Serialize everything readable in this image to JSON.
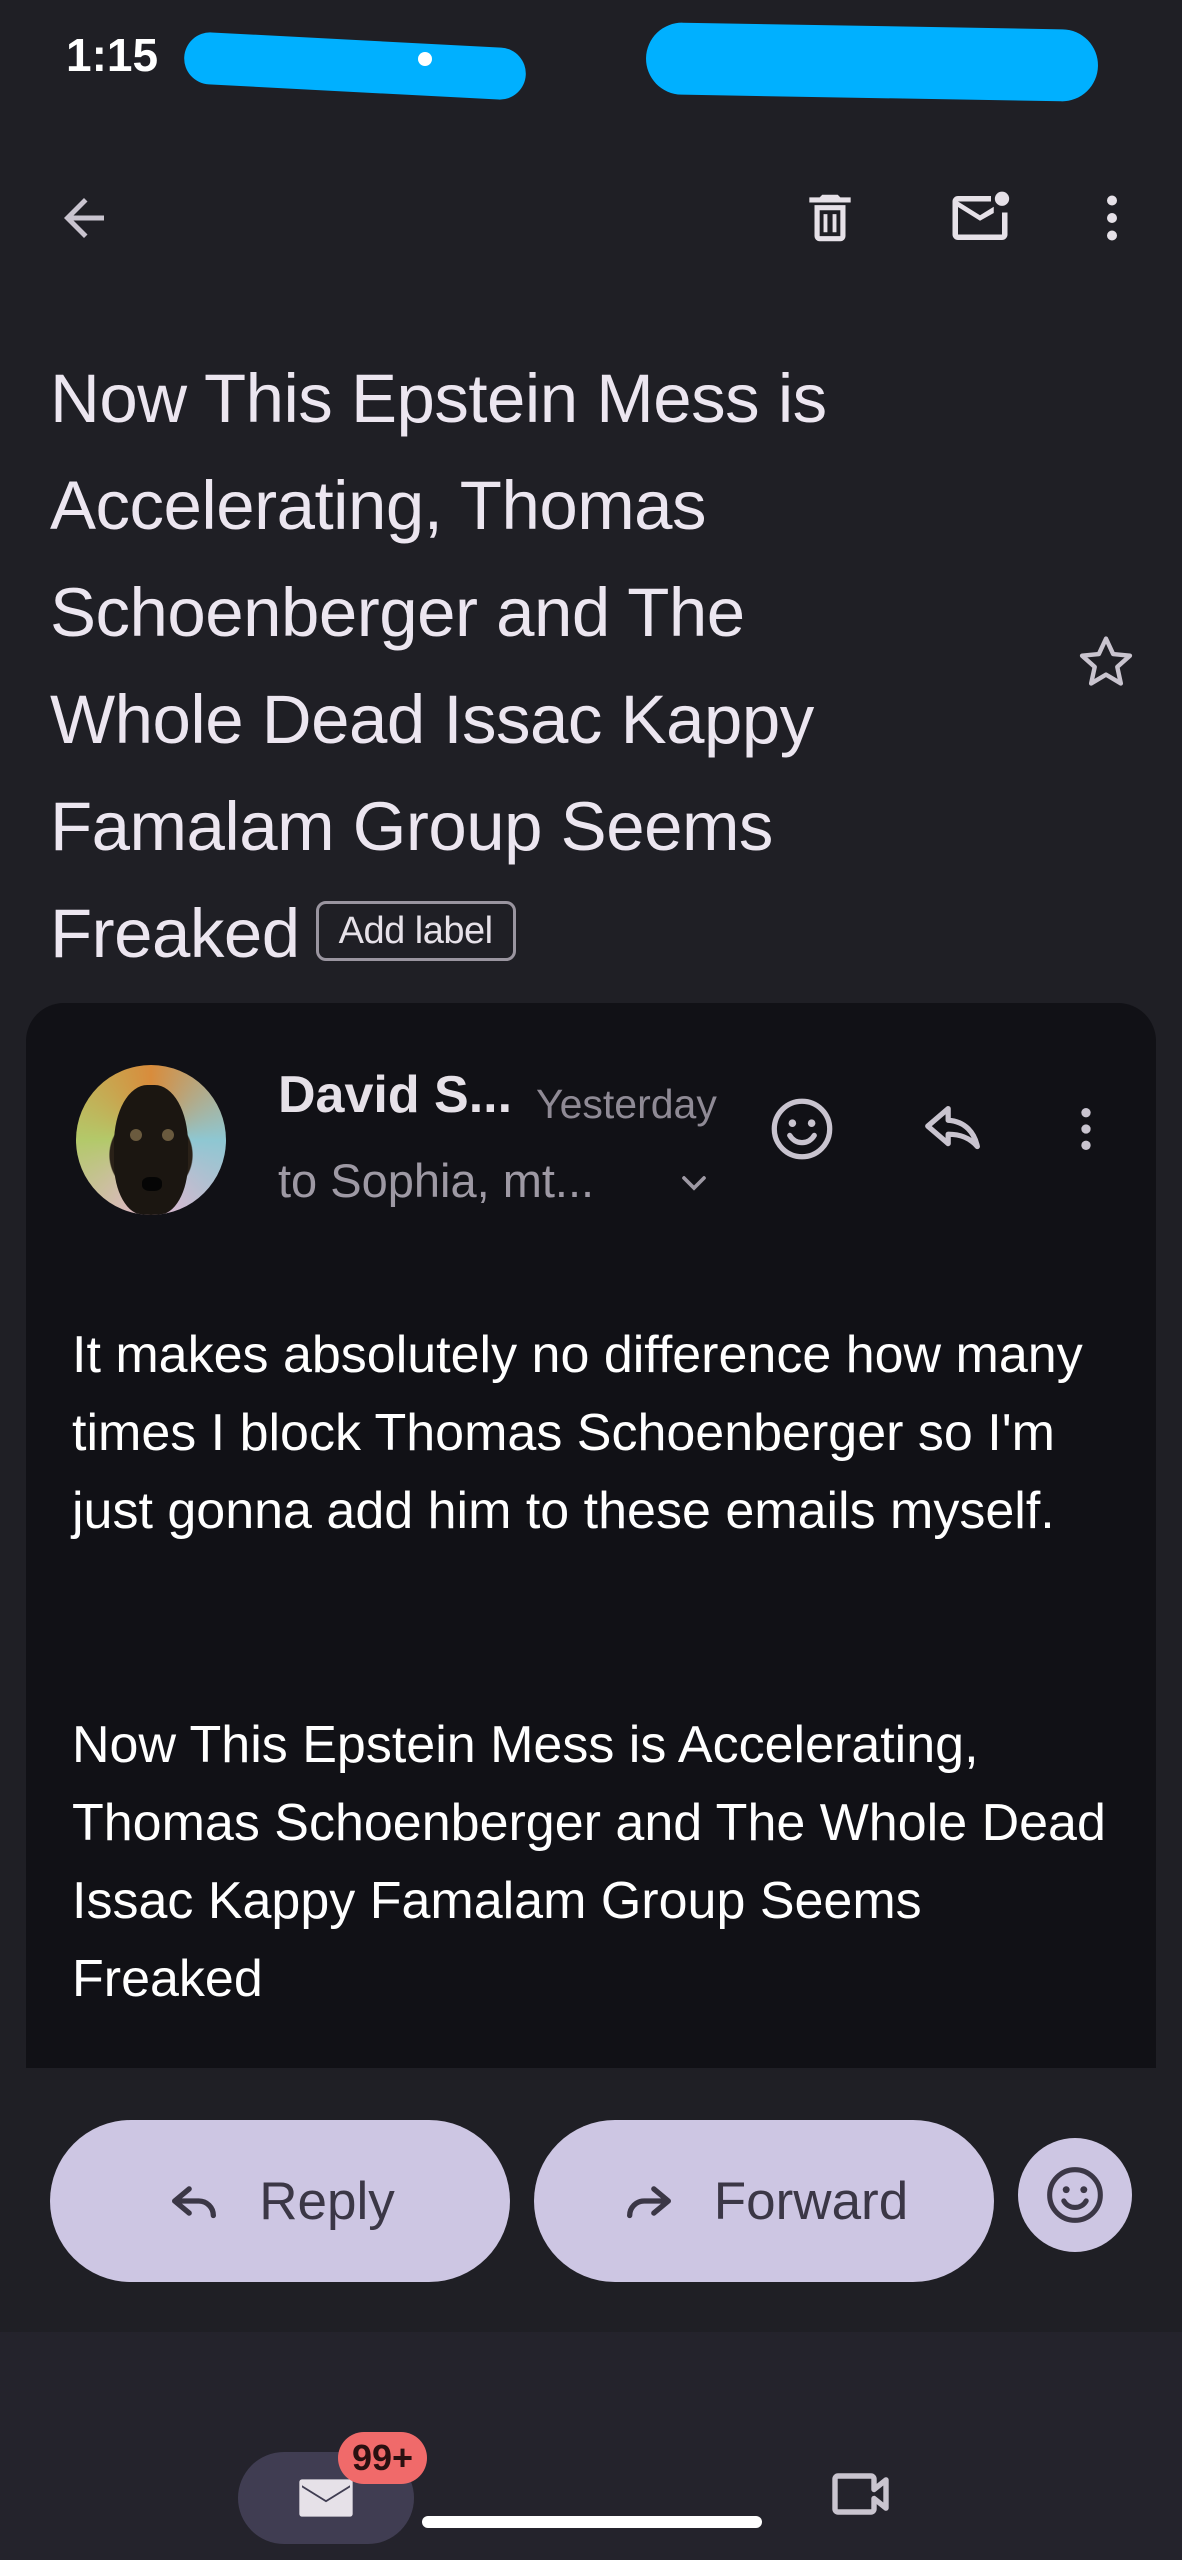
{
  "status_bar": {
    "time": "1:15"
  },
  "email": {
    "subject": "Now This Epstein Mess is Accelerating, Thomas Schoenberger and The Whole Dead Issac Kappy Famalam Group Seems Freaked",
    "add_label": "Add label",
    "sender": "David S...",
    "date": "Yesterday",
    "recipients": "to Sophia, mt...",
    "body_paragraphs": [
      "It makes absolutely no difference how many times I block Thomas Schoenberger so I'm just gonna add him to these emails myself.",
      "Now This Epstein Mess is Accelerating, Thomas Schoenberger and The Whole Dead Issac Kappy Famalam Group Seems Freaked"
    ]
  },
  "actions": {
    "reply_label": "Reply",
    "forward_label": "Forward"
  },
  "bottom_nav": {
    "mail_badge": "99+"
  },
  "colors": {
    "background": "#1f1f25",
    "card": "#111116",
    "pill": "#cdc6e3",
    "badge": "#f06a6a",
    "redaction": "#00b0ff"
  },
  "icons": [
    "back-arrow-icon",
    "trash-icon",
    "mark-unread-icon",
    "more-vert-icon",
    "star-icon",
    "emoji-icon",
    "reply-icon",
    "forward-icon",
    "chevron-down-icon",
    "mail-icon",
    "video-icon"
  ]
}
